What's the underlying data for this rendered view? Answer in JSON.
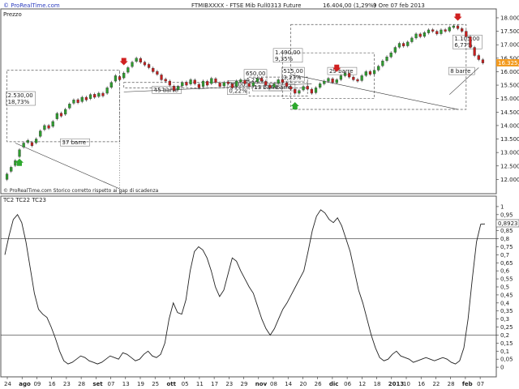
{
  "header": {
    "site": "© ProRealTime.com",
    "instrument": "FTMIBXXXX - FTSE Mib Full0313 Future",
    "quote": "16.404,00 (1,29%)",
    "period": "9 Ore  07 feb 2013"
  },
  "price_panel": {
    "label": "Prezzo",
    "footer": "© ProRealTime.com  Storico corretto rispetto ai gap di scadenza",
    "last_price_label": "16.325,0",
    "annotations": [
      {
        "text": "2.530,00",
        "text2": "18,73%"
      },
      {
        "text": "37 barre"
      },
      {
        "text": "45 barre"
      },
      {
        "text": "35,00",
        "text2": "0,22%"
      },
      {
        "text": "650,00",
        "text2": "4,22%"
      },
      {
        "text": "13 barre"
      },
      {
        "text": "1.490,00",
        "text2": "9,35%"
      },
      {
        "text": "515,00",
        "text2": "3,23%"
      },
      {
        "text": "4 barre"
      },
      {
        "text": "29 barre"
      },
      {
        "text": "1.105,00",
        "text2": "6,77%"
      },
      {
        "text": "8 barre"
      }
    ]
  },
  "osc_panel": {
    "label": "TC2 TC22 TC23",
    "last_value_label": "0,8923"
  },
  "colors": {
    "up": "#2e9e2e",
    "down": "#c81e1e",
    "line": "#222222",
    "dashed": "#555555",
    "arrow_up": "#2ea82e",
    "arrow_down": "#d02020",
    "price_tag": "#f29a1f"
  },
  "chart_data": [
    {
      "type": "candlestick",
      "title": "FTMIBXXXX - FTSE Mib Full0313 Future",
      "ylim": [
        11500,
        18300
      ],
      "y_ticks": [
        12000,
        12500,
        13000,
        13500,
        14000,
        14500,
        15000,
        15500,
        16000,
        16500,
        17000,
        17500,
        18000
      ],
      "y_tick_labels": [
        "12.000",
        "12.500",
        "13.000",
        "13.500",
        "14.000",
        "14.500",
        "15.000",
        "15.500",
        "16.000",
        "16.500",
        "17.000",
        "17.500",
        "18.000"
      ],
      "x_labels": [
        "24",
        "ago",
        "09",
        "16",
        "23",
        "28",
        "set",
        "07",
        "13",
        "19",
        "25",
        "ott",
        "05",
        "11",
        "17",
        "23",
        "29",
        "nov",
        "08",
        "14",
        "20",
        "26",
        "dic",
        "06",
        "12",
        "18",
        "2013",
        "10",
        "16",
        "22",
        "28",
        "feb",
        "07"
      ],
      "series_close": [
        12200,
        12450,
        12700,
        13100,
        13350,
        13450,
        13250,
        13500,
        13800,
        14000,
        13900,
        14150,
        14450,
        14350,
        14600,
        14800,
        14950,
        14850,
        15050,
        14950,
        15150,
        15050,
        15200,
        15100,
        15400,
        15600,
        15850,
        15700,
        15950,
        16150,
        16350,
        16500,
        16350,
        16250,
        16150,
        16000,
        15900,
        15700,
        15650,
        15500,
        15300,
        15450,
        15600,
        15500,
        15700,
        15550,
        15400,
        15650,
        15500,
        15750,
        15600,
        15450,
        15600,
        15550,
        15400,
        15650,
        15700,
        15550,
        15450,
        15600,
        15750,
        15650,
        15500,
        15400,
        15550,
        15700,
        15600,
        15450,
        15350,
        15200,
        15300,
        15450,
        15350,
        15200,
        15400,
        15550,
        15650,
        15750,
        15600,
        15700,
        15850,
        15950,
        15800,
        15700,
        15650,
        15850,
        16000,
        15900,
        16050,
        16200,
        16400,
        16550,
        16700,
        16900,
        17050,
        16950,
        17100,
        17250,
        17400,
        17300,
        17450,
        17550,
        17500,
        17400,
        17550,
        17500,
        17650,
        17700,
        17600,
        17500,
        17300,
        16900,
        16600,
        16450,
        16325
      ],
      "series_open_offset": [
        -200,
        -150,
        -180,
        -250,
        -150,
        -80,
        120,
        -140,
        -200,
        -150,
        100,
        -180,
        -200,
        110,
        -180,
        -150,
        -120,
        110,
        -160,
        100,
        -150,
        110,
        -120,
        100,
        -200,
        -180,
        -200,
        120,
        -180,
        -170,
        -160,
        -120,
        140,
        100,
        120,
        130,
        110,
        180,
        70,
        150,
        160,
        -120,
        -130,
        110,
        -160,
        140,
        130,
        -200,
        140,
        -190,
        140,
        130,
        -130,
        70,
        150,
        -200,
        -80,
        130,
        110,
        -130,
        -130,
        110,
        140,
        100,
        -130,
        -130,
        110,
        140,
        100,
        150,
        -100,
        -130,
        110,
        150,
        -180,
        -130,
        -100,
        -110,
        140,
        -110,
        -140,
        -100,
        140,
        100,
        60,
        -180,
        -140,
        110,
        -130,
        -140,
        -180,
        -140,
        -150,
        -180,
        -140,
        100,
        -140,
        -140,
        -150,
        100,
        -140,
        -110,
        60,
        100,
        -140,
        60,
        -140,
        -60,
        100,
        100,
        200,
        400,
        300,
        150,
        120
      ],
      "arrows": [
        {
          "kind": "down",
          "bar": 28
        },
        {
          "kind": "up",
          "bar": 3
        },
        {
          "kind": "up",
          "bar": 69
        },
        {
          "kind": "down",
          "bar": 79
        },
        {
          "kind": "down",
          "bar": 108
        }
      ]
    },
    {
      "type": "line",
      "title": "TC2 TC22 TC23",
      "ylim": [
        -0.05,
        1.05
      ],
      "y_ticks": [
        0,
        0.05,
        0.1,
        0.15,
        0.2,
        0.25,
        0.3,
        0.35,
        0.4,
        0.45,
        0.5,
        0.55,
        0.6,
        0.65,
        0.7,
        0.75,
        0.8,
        0.85,
        0.9,
        0.95,
        1
      ],
      "y_tick_labels": [
        "0",
        "0,05",
        "0,1",
        "0,15",
        "0,2",
        "0,25",
        "0,3",
        "0,35",
        "0,4",
        "0,45",
        "0,5",
        "0,55",
        "0,6",
        "0,65",
        "0,7",
        "0,75",
        "0,8",
        "0,85",
        "0,9",
        "0,95",
        "1"
      ],
      "hlines": [
        0.2,
        0.8
      ],
      "values": [
        0.7,
        0.82,
        0.92,
        0.95,
        0.9,
        0.78,
        0.62,
        0.46,
        0.36,
        0.33,
        0.31,
        0.25,
        0.18,
        0.1,
        0.04,
        0.02,
        0.03,
        0.05,
        0.07,
        0.06,
        0.04,
        0.03,
        0.02,
        0.03,
        0.05,
        0.07,
        0.06,
        0.05,
        0.09,
        0.08,
        0.06,
        0.04,
        0.05,
        0.08,
        0.1,
        0.07,
        0.06,
        0.08,
        0.15,
        0.3,
        0.4,
        0.34,
        0.33,
        0.42,
        0.6,
        0.72,
        0.75,
        0.73,
        0.68,
        0.6,
        0.5,
        0.44,
        0.48,
        0.58,
        0.68,
        0.66,
        0.6,
        0.55,
        0.5,
        0.46,
        0.38,
        0.3,
        0.24,
        0.2,
        0.24,
        0.3,
        0.36,
        0.4,
        0.45,
        0.5,
        0.55,
        0.6,
        0.72,
        0.85,
        0.94,
        0.98,
        0.96,
        0.92,
        0.9,
        0.93,
        0.88,
        0.8,
        0.72,
        0.6,
        0.48,
        0.4,
        0.3,
        0.2,
        0.12,
        0.06,
        0.04,
        0.05,
        0.08,
        0.1,
        0.07,
        0.06,
        0.05,
        0.03,
        0.04,
        0.05,
        0.06,
        0.05,
        0.04,
        0.05,
        0.06,
        0.05,
        0.03,
        0.02,
        0.04,
        0.12,
        0.3,
        0.55,
        0.78,
        0.89,
        0.8923
      ]
    }
  ]
}
